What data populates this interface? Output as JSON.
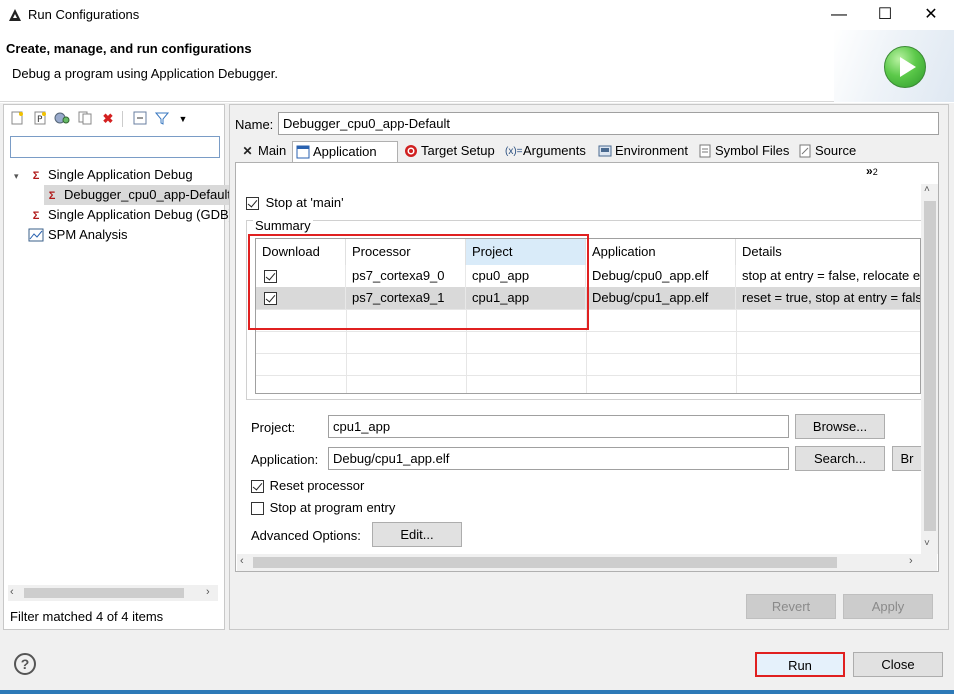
{
  "window": {
    "title": "Run Configurations",
    "minimize": "—",
    "maximize": "☐",
    "close": "✕"
  },
  "header": {
    "title": "Create, manage, and run configurations",
    "subtitle": "Debug a program using Application Debugger."
  },
  "left": {
    "filter_placeholder": "",
    "tree": [
      {
        "label": "Single Application Debug",
        "icon": "tcf-icon",
        "expanded": true
      },
      {
        "label": "Debugger_cpu0_app-Default",
        "icon": "tcf-icon",
        "selected": true
      },
      {
        "label": "Single Application Debug (GDB)",
        "icon": "gdb-icon"
      },
      {
        "label": "SPM Analysis",
        "icon": "chart-icon"
      }
    ],
    "status": "Filter matched 4 of 4 items"
  },
  "right": {
    "name_label": "Name:",
    "name_value": "Debugger_cpu0_app-Default",
    "tabs": [
      "Main",
      "Application",
      "Target Setup",
      "Arguments",
      "Environment",
      "Symbol Files",
      "Source"
    ],
    "overflow": "»",
    "overflow_count": "2",
    "stop_at_main": "Stop at 'main'",
    "summary_label": "Summary",
    "columns": [
      "Download",
      "Processor",
      "Project",
      "Application",
      "Details"
    ],
    "rows": [
      {
        "download": true,
        "processor": "ps7_cortexa9_0",
        "project": "cpu0_app",
        "application": "Debug/cpu0_app.elf",
        "details": "stop at entry = false, relocate executable = false"
      },
      {
        "download": true,
        "processor": "ps7_cortexa9_1",
        "project": "cpu1_app",
        "application": "Debug/cpu1_app.elf",
        "details": "reset = true, stop at entry = false"
      }
    ],
    "project_label": "Project:",
    "project_value": "cpu1_app",
    "browse_button": "Browse...",
    "application_label": "Application:",
    "application_value": "Debug/cpu1_app.elf",
    "search_button": "Search...",
    "extra_button": "Br",
    "reset_processor": "Reset processor",
    "stop_at_entry": "Stop at program entry",
    "advanced_label": "Advanced Options:",
    "edit_button": "Edit...",
    "revert_button": "Revert",
    "apply_button": "Apply"
  },
  "footer": {
    "help": "?",
    "run_button": "Run",
    "close_button": "Close"
  },
  "colors": {
    "highlight_box": "#e02020",
    "selection": "#cce8ff",
    "accent": "#2d7ab8"
  }
}
